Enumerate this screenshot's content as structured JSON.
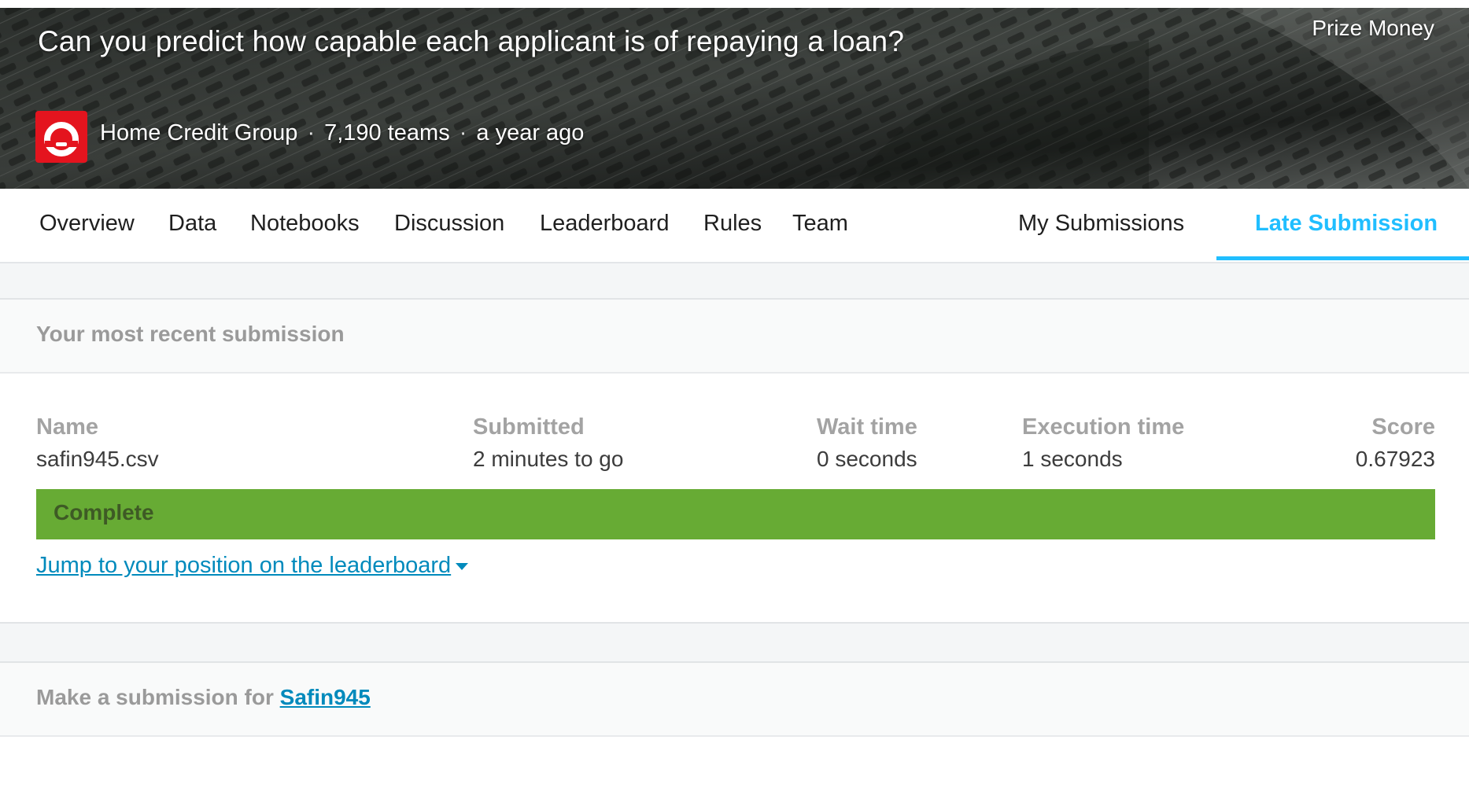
{
  "banner": {
    "title": "Can you predict how capable each applicant is of repaying a loan?",
    "prize_label": "Prize Money",
    "host": "Home Credit Group",
    "teams": "7,190 teams",
    "age": "a year ago",
    "separator": "·"
  },
  "nav": {
    "items": [
      {
        "label": "Overview"
      },
      {
        "label": "Data"
      },
      {
        "label": "Notebooks"
      },
      {
        "label": "Discussion"
      },
      {
        "label": "Leaderboard"
      },
      {
        "label": "Rules"
      },
      {
        "label": "Team"
      },
      {
        "label": "My Submissions"
      },
      {
        "label": "Late Submission"
      }
    ],
    "active": "Late Submission"
  },
  "recent": {
    "heading": "Your most recent submission",
    "columns": [
      {
        "label": "Name",
        "value": "safin945.csv"
      },
      {
        "label": "Submitted",
        "value": "2 minutes to go"
      },
      {
        "label": "Wait time",
        "value": "0 seconds"
      },
      {
        "label": "Execution time",
        "value": "1 seconds"
      },
      {
        "label": "Score",
        "value": "0.67923"
      }
    ],
    "status": "Complete",
    "jump_link": "Jump to your position on the leaderboard"
  },
  "make_submission": {
    "prefix": "Make a submission for",
    "user": "Safin945"
  },
  "colors": {
    "accent": "#20beff",
    "link": "#008abc",
    "status_green": "#67ab34",
    "host_logo_red": "#e4141e"
  }
}
